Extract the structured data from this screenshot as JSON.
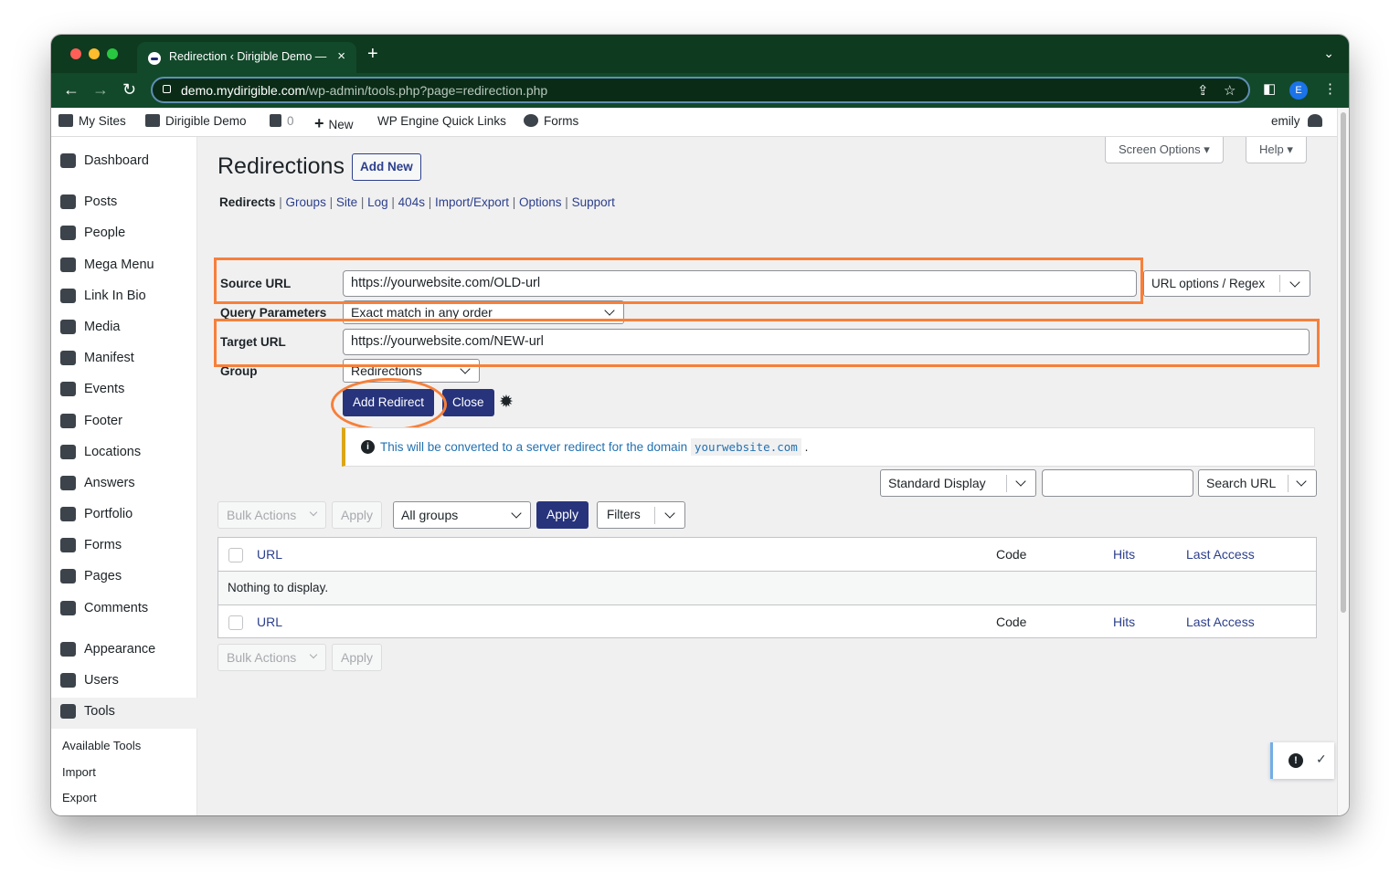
{
  "browser": {
    "tab_title": "Redirection ‹ Dirigible Demo —",
    "url_domain": "demo.mydirigible.com",
    "url_path": "/wp-admin/tools.php?page=redirection.php",
    "profile_initial": "E"
  },
  "admin_bar": {
    "my_sites": "My Sites",
    "site_name": "Dirigible Demo",
    "comments_count": "0",
    "new": "New",
    "quick_links": "WP Engine Quick Links",
    "forms": "Forms",
    "user": "emily"
  },
  "sidebar": {
    "items": [
      {
        "label": "Dashboard",
        "icon": "dashboard-icon"
      },
      {
        "label": "Posts",
        "icon": "pin-icon"
      },
      {
        "label": "People",
        "icon": "person-icon"
      },
      {
        "label": "Mega Menu",
        "icon": "grid-icon"
      },
      {
        "label": "Link In Bio",
        "icon": "share-icon"
      },
      {
        "label": "Media",
        "icon": "media-icon"
      },
      {
        "label": "Manifest",
        "icon": "folder-icon"
      },
      {
        "label": "Events",
        "icon": "calendar-icon"
      },
      {
        "label": "Footer",
        "icon": "grid-icon"
      },
      {
        "label": "Locations",
        "icon": "map-icon"
      },
      {
        "label": "Answers",
        "icon": "help-icon"
      },
      {
        "label": "Portfolio",
        "icon": "portfolio-icon"
      },
      {
        "label": "Forms",
        "icon": "forms-icon"
      },
      {
        "label": "Pages",
        "icon": "pages-icon"
      },
      {
        "label": "Comments",
        "icon": "comment-icon"
      },
      {
        "label": "Appearance",
        "icon": "brush-icon"
      },
      {
        "label": "Users",
        "icon": "users-icon"
      },
      {
        "label": "Tools",
        "icon": "wrench-icon"
      }
    ],
    "sub": [
      "Available Tools",
      "Import",
      "Export"
    ]
  },
  "top_buttons": {
    "screen_options": "Screen Options ▾",
    "help": "Help ▾"
  },
  "page": {
    "title": "Redirections",
    "add_new": "Add New",
    "subnav": [
      "Redirects",
      "Groups",
      "Site",
      "Log",
      "404s",
      "Import/Export",
      "Options",
      "Support"
    ]
  },
  "form": {
    "source_label": "Source URL",
    "source_value": "https://yourwebsite.com/OLD-url",
    "url_options": "URL options / Regex",
    "query_label": "Query Parameters",
    "query_value": "Exact match in any order",
    "target_label": "Target URL",
    "target_value": "https://yourwebsite.com/NEW-url",
    "group_label": "Group",
    "group_value": "Redirections",
    "add_redirect": "Add Redirect",
    "close": "Close"
  },
  "notice": {
    "text": "This will be converted to a server redirect for the domain",
    "domain": "yourwebsite.com",
    "end": "."
  },
  "display": {
    "standard": "Standard Display",
    "search_value": "",
    "search_url": "Search URL"
  },
  "bulk": {
    "actions": "Bulk Actions",
    "apply": "Apply",
    "all_groups": "All groups",
    "apply_primary": "Apply",
    "filters": "Filters"
  },
  "table": {
    "columns": [
      "URL",
      "Code",
      "Hits",
      "Last Access"
    ],
    "empty": "Nothing to display."
  },
  "colors": {
    "accent": "#27347c",
    "highlight": "#f7803a",
    "browser_frame": "#12492a"
  }
}
